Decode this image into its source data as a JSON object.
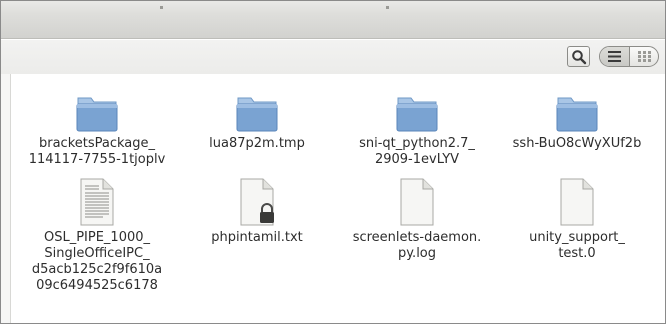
{
  "files": [
    {
      "name": "bracketsPackage_\n114117-7755-1tjoplv",
      "type": "folder-icon"
    },
    {
      "name": "lua87p2m.tmp",
      "type": "folder-icon"
    },
    {
      "name": "sni-qt_python2.7_\n2909-1evLYV",
      "type": "folder-icon"
    },
    {
      "name": "ssh-BuO8cWyXUf2b",
      "type": "folder-icon"
    },
    {
      "name": "OSL_PIPE_1000_\nSingleOfficeIPC_\nd5acb125c2f9f610a\n09c6494525c6178",
      "type": "text-file-icon"
    },
    {
      "name": "phpintamil.txt",
      "type": "locked-file-icon"
    },
    {
      "name": "screenlets-daemon.\npy.log",
      "type": "file-icon"
    },
    {
      "name": "unity_support_\ntest.0",
      "type": "file-icon"
    }
  ],
  "colors": {
    "folder_top": "#a9c6e6",
    "folder_body": "#7aa3d2",
    "folder_dark": "#5a86ba"
  }
}
